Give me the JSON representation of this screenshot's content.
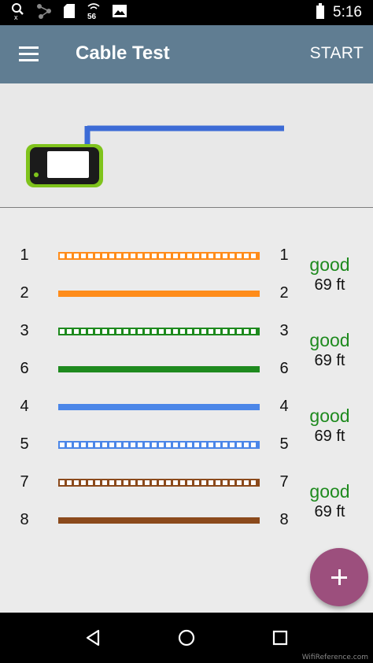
{
  "status_bar": {
    "time": "5:16",
    "network_label": "56"
  },
  "app_bar": {
    "title": "Cable Test",
    "action_label": "START"
  },
  "colors": {
    "app_bar": "#607d92",
    "fab": "#9c4f7d",
    "status_good": "#1e8a1e",
    "map_wire": "#3c6bd6",
    "device_outline": "#7fc31c"
  },
  "wires": [
    {
      "left_pin": "1",
      "right_pin": "1",
      "color": "#ff8c1a",
      "style": "striped"
    },
    {
      "left_pin": "2",
      "right_pin": "2",
      "color": "#ff8c1a",
      "style": "solid"
    },
    {
      "left_pin": "3",
      "right_pin": "3",
      "color": "#1e8a1e",
      "style": "striped"
    },
    {
      "left_pin": "6",
      "right_pin": "6",
      "color": "#1e8a1e",
      "style": "solid"
    },
    {
      "left_pin": "4",
      "right_pin": "4",
      "color": "#4b86e8",
      "style": "solid"
    },
    {
      "left_pin": "5",
      "right_pin": "5",
      "color": "#4b86e8",
      "style": "striped"
    },
    {
      "left_pin": "7",
      "right_pin": "7",
      "color": "#8b4a1c",
      "style": "striped"
    },
    {
      "left_pin": "8",
      "right_pin": "8",
      "color": "#8b4a1c",
      "style": "solid"
    }
  ],
  "pairs": [
    {
      "status": "good",
      "length": "69 ft"
    },
    {
      "status": "good",
      "length": "69 ft"
    },
    {
      "status": "good",
      "length": "69 ft"
    },
    {
      "status": "good",
      "length": "69 ft"
    }
  ],
  "icons": {
    "status_left": [
      "search-x-icon",
      "share-icon",
      "sd-card-icon",
      "network-icon",
      "image-icon"
    ],
    "status_right": [
      "battery-icon"
    ],
    "fab": "plus-icon",
    "nav": [
      "back-icon",
      "home-icon",
      "recents-icon"
    ]
  },
  "watermark": "WifiReference.com"
}
